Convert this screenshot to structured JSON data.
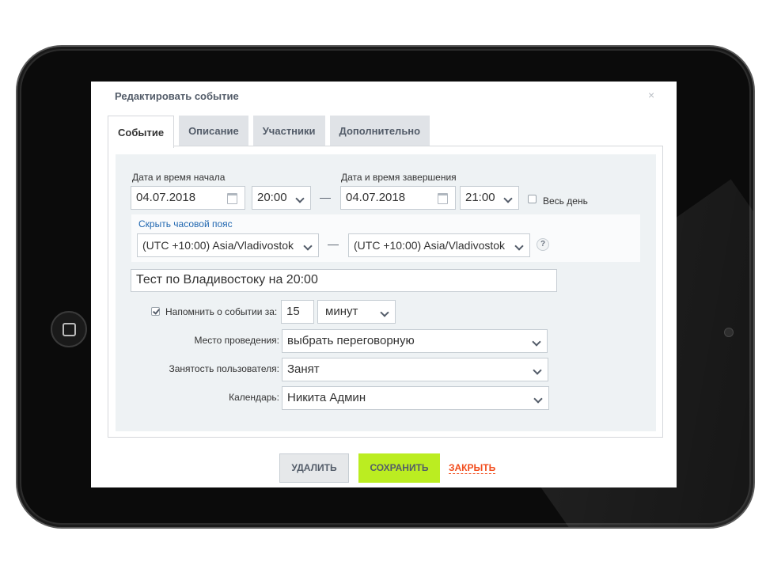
{
  "dialog": {
    "title": "Редактировать событие",
    "close_glyph": "×"
  },
  "tabs": [
    {
      "label": "Событие",
      "active": true
    },
    {
      "label": "Описание",
      "active": false
    },
    {
      "label": "Участники",
      "active": false
    },
    {
      "label": "Дополнительно",
      "active": false
    }
  ],
  "event": {
    "start_label": "Дата и время начала",
    "start_date": "04.07.2018",
    "start_time": "20:00",
    "end_label": "Дата и время завершения",
    "end_date": "04.07.2018",
    "end_time": "21:00",
    "dash": "—",
    "all_day_label": "Весь день",
    "all_day_checked": false,
    "timezone_link": "Скрыть часовой пояс",
    "timezone_from": "(UTC +10:00) Asia/Vladivostok",
    "timezone_to": "(UTC +10:00) Asia/Vladivostok",
    "timezone_help": "?",
    "name": "Тест по Владивостоку на 20:00",
    "remind_label": "Напомнить о событии за:",
    "remind_checked": true,
    "remind_value": "15",
    "remind_unit": "минут",
    "location_label": "Место проведения:",
    "location_value": "выбрать переговорную",
    "availability_label": "Занятость пользователя:",
    "availability_value": "Занят",
    "calendar_label": "Календарь:",
    "calendar_value": "Никита Админ"
  },
  "buttons": {
    "delete": "УДАЛИТЬ",
    "save": "СОХРАНИТЬ",
    "close": "ЗАКРЫТЬ"
  },
  "icons": [
    "calendar-icon",
    "chevron-down-icon",
    "help-icon",
    "checkbox-icon",
    "close-icon",
    "home-button-icon"
  ]
}
